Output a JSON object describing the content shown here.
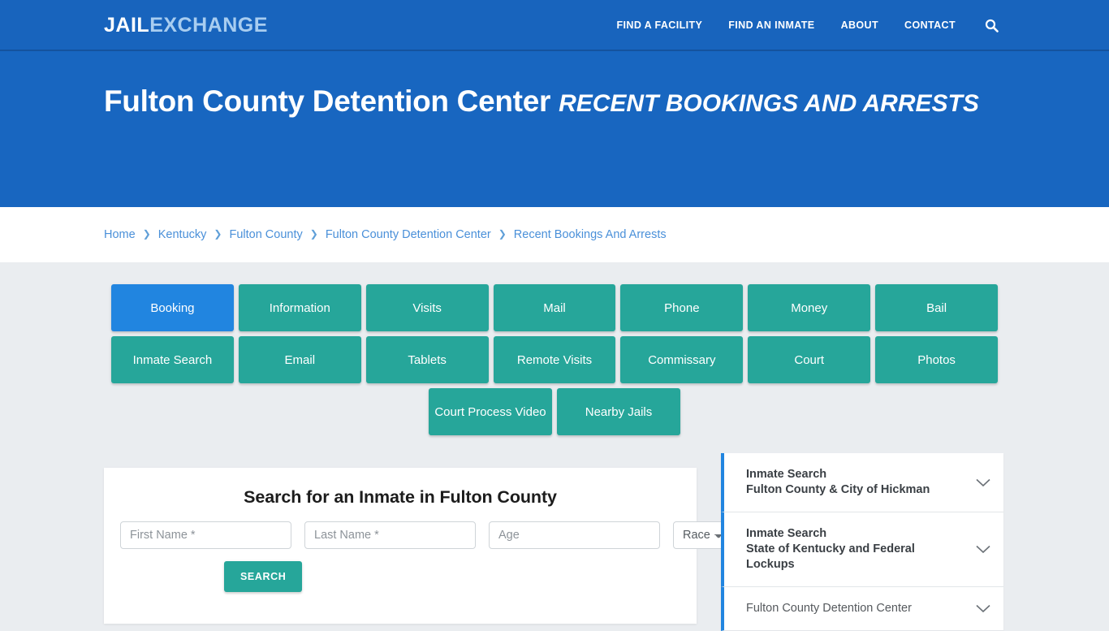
{
  "brand": {
    "part1": "JAIL",
    "part2": "EXCHANGE"
  },
  "nav": {
    "items": [
      {
        "label": "FIND A FACILITY"
      },
      {
        "label": "FIND AN INMATE"
      },
      {
        "label": "ABOUT"
      },
      {
        "label": "CONTACT"
      }
    ],
    "search_icon": "search-icon"
  },
  "hero": {
    "facility": "Fulton County Detention Center",
    "section": "Recent Bookings and Arrests"
  },
  "breadcrumb": {
    "separator": "❯",
    "items": [
      {
        "label": "Home"
      },
      {
        "label": "Kentucky"
      },
      {
        "label": "Fulton County"
      },
      {
        "label": "Fulton County Detention Center"
      },
      {
        "label": "Recent Bookings And Arrests"
      }
    ]
  },
  "tabs": {
    "active": "Booking",
    "row1": [
      {
        "label": "Booking",
        "active": true
      },
      {
        "label": "Information"
      },
      {
        "label": "Visits"
      },
      {
        "label": "Mail"
      },
      {
        "label": "Phone"
      },
      {
        "label": "Money"
      },
      {
        "label": "Bail"
      }
    ],
    "row2": [
      {
        "label": "Inmate Search"
      },
      {
        "label": "Email"
      },
      {
        "label": "Tablets"
      },
      {
        "label": "Remote Visits"
      },
      {
        "label": "Commissary"
      },
      {
        "label": "Court"
      },
      {
        "label": "Photos"
      }
    ],
    "row3": [
      {
        "label": "Court Process Video"
      },
      {
        "label": "Nearby Jails"
      }
    ]
  },
  "search_form": {
    "heading": "Search for an Inmate in Fulton County",
    "first_name_placeholder": "First Name *",
    "last_name_placeholder": "Last Name *",
    "age_placeholder": "Age",
    "race_selected": "Race",
    "race_options": [
      "Race"
    ],
    "submit_label": "SEARCH"
  },
  "aside": {
    "items": [
      {
        "line1": "Inmate Search",
        "line2": "Fulton County & City of Hickman",
        "line3": ""
      },
      {
        "line1": "Inmate Search",
        "line2": "State of Kentucky and Federal",
        "line3": "Lockups"
      },
      {
        "line1": "Fulton County Detention Center",
        "line2": "",
        "line3": ""
      }
    ]
  },
  "colors": {
    "header_blue": "#1866c0",
    "nav_blue": "#1864bd",
    "accent_teal": "#26a69a",
    "active_blue": "#2185e0",
    "page_bg": "#eaedf0",
    "link_blue": "#4a90d9"
  }
}
